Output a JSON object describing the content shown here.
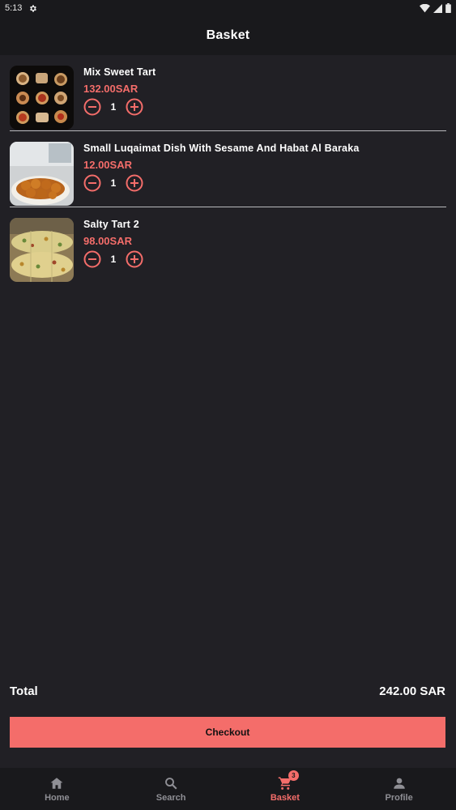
{
  "status_bar": {
    "time": "5:13"
  },
  "header": {
    "title": "Basket"
  },
  "basket": {
    "items": [
      {
        "name": "Mix Sweet Tart",
        "price": "132.00SAR",
        "quantity": "1"
      },
      {
        "name": "Small Luqaimat Dish With Sesame And Habat Al Baraka",
        "price": "12.00SAR",
        "quantity": "1"
      },
      {
        "name": "Salty Tart 2",
        "price": "98.00SAR",
        "quantity": "1"
      }
    ]
  },
  "summary": {
    "total_label": "Total",
    "total_value": "242.00 SAR"
  },
  "checkout_label": "Checkout",
  "nav": {
    "items": [
      {
        "label": "Home",
        "icon": "home-icon"
      },
      {
        "label": "Search",
        "icon": "search-icon"
      },
      {
        "label": "Basket",
        "icon": "cart-icon",
        "badge": "3",
        "active": true
      },
      {
        "label": "Profile",
        "icon": "person-icon"
      }
    ]
  },
  "colors": {
    "background": "#212025",
    "bar": "#19191c",
    "accent": "#f46d6a",
    "divider": "#b9b9bd",
    "inactive": "#8f8f95"
  }
}
